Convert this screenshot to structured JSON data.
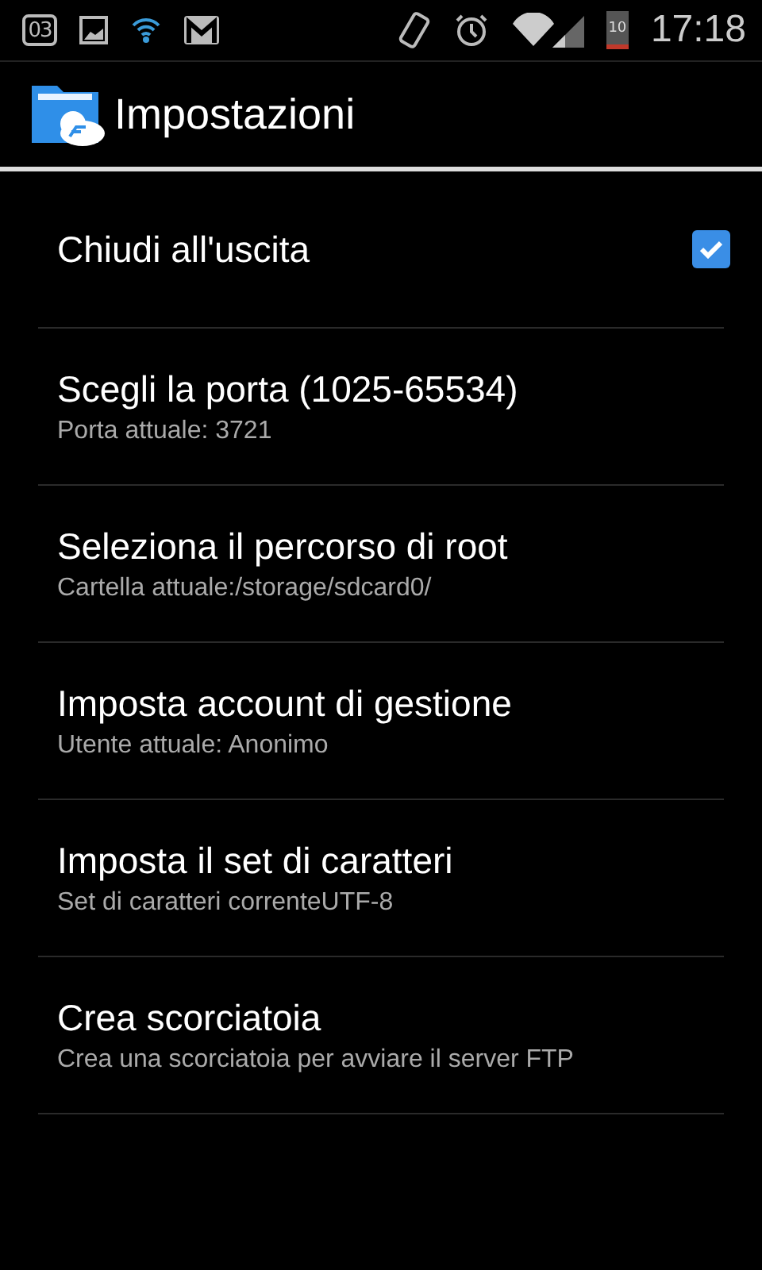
{
  "status_bar": {
    "calendar_day": "03",
    "battery": "10",
    "time": "17:18"
  },
  "action_bar": {
    "title": "Impostazioni"
  },
  "settings": [
    {
      "kind": "checkbox",
      "title": "Chiudi all'uscita",
      "checked": true
    },
    {
      "kind": "text",
      "title": "Scegli la porta (1025-65534)",
      "summary": "Porta attuale: 3721"
    },
    {
      "kind": "text",
      "title": "Seleziona il percorso di root",
      "summary": "Cartella attuale:/storage/sdcard0/"
    },
    {
      "kind": "text",
      "title": "Imposta account di gestione",
      "summary": "Utente attuale: Anonimo"
    },
    {
      "kind": "text",
      "title": "Imposta il set di caratteri",
      "summary": "Set di caratteri correnteUTF-8"
    },
    {
      "kind": "text",
      "title": "Crea scorciatoia",
      "summary": "Crea una scorciatoia per avviare il server FTP"
    }
  ]
}
